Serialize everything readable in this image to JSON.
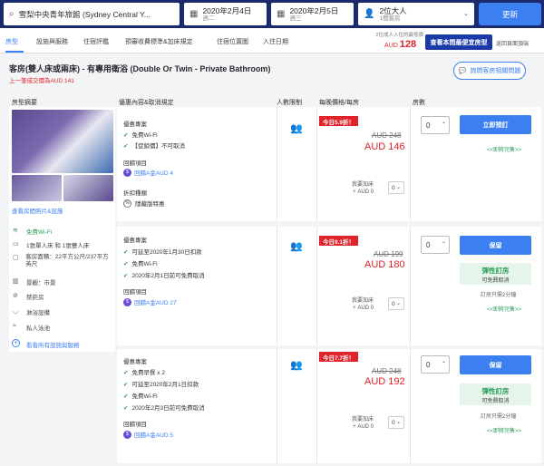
{
  "search": {
    "hotel": "雪梨中央青年旅館 (Sydney Central Y...",
    "checkin_date": "2020年2月4日",
    "checkin_day": "週二",
    "checkout_date": "2020年2月5日",
    "checkout_day": "週三",
    "guests": "2位大人",
    "rooms": "1間客房",
    "update_button": "更新"
  },
  "tabs": [
    "房型",
    "設施與服務",
    "住宿評鑑",
    "預審收費標準&加床規定",
    "住宿位置圖",
    "入住日期"
  ],
  "header": {
    "note": "2位成人入住的最低價",
    "price_prefix": "AUD",
    "price_value": "128",
    "best_price_button": "查看本間最便宜房型",
    "back_link": "返回頁面頂端"
  },
  "room": {
    "title": "客房(雙人床或兩床) - 有專用衛浴 (Double Or Twin - Private Bathroom)",
    "previous_price": "上一筆成交價為AUD 141",
    "ask_button": "詢問客房相關問題",
    "photos_link": "查看房間照片&設施"
  },
  "columns": {
    "room_type": "房型摘要",
    "benefits": "優惠內容&取消規定",
    "capacity": "人數限制",
    "price": "每晚價格/每房",
    "rooms": "房數"
  },
  "amenities": [
    {
      "icon": "wifi-icon",
      "label": "免費Wi-Fi"
    },
    {
      "icon": "bed-icon",
      "label": "1張單人床 和 1張雙人床"
    },
    {
      "icon": "size-icon",
      "label": "客房面積：22平方公尺/237平方英尺"
    },
    {
      "icon": "city-view-icon",
      "label": "景觀：市景"
    },
    {
      "icon": "no-smoking-icon",
      "label": "禁菸房"
    },
    {
      "icon": "bath-icon",
      "label": "淋浴設備"
    },
    {
      "icon": "pool-icon",
      "label": "私人泳池"
    }
  ],
  "all_amenities_link": "看看所有設施與服務",
  "offers": [
    {
      "benefits_title": "優惠專案",
      "benefits": [
        "免費Wi-Fi",
        "【促銷價】不可取消"
      ],
      "cashback_title": "回饋項目",
      "cashback": "回饋A金AUD 4",
      "discount_title": "折扣種類",
      "discount": "隱藏版特惠",
      "discount_badge": "今日5.9折！",
      "original_price": "AUD 248",
      "current_price": "AUD 146",
      "extra_bed_label": "我要加床",
      "extra_bed_price": "+ AUD 0",
      "extra_bed_qty": "0",
      "qty": "0",
      "book_button": "立即預訂",
      "few_left": "<<即將完售>>"
    },
    {
      "benefits_title": "優惠專案",
      "benefits": [
        "可延至2020年1月30日扣款",
        "免費Wi-Fi",
        "2020年2月1日前可免費取消"
      ],
      "cashback_title": "回饋項目",
      "cashback": "回饋A金AUD 27",
      "discount_badge": "今日9.1折！",
      "original_price": "AUD 199",
      "current_price": "AUD 180",
      "extra_bed_label": "我要加床",
      "extra_bed_price": "+ AUD 0",
      "extra_bed_qty": "0",
      "qty": "0",
      "book_button": "保留",
      "flex_title": "彈性訂房",
      "flex_sub": "可免費取消",
      "rooms_left": "訂房只需2分鐘",
      "few_left": "<<即將完售>>"
    },
    {
      "benefits_title": "優惠專案",
      "benefits": [
        "免費早餐 x 2",
        "可延至2020年2月1日扣款",
        "免費Wi-Fi",
        "2020年2月3日前可免費取消"
      ],
      "cashback_title": "回饋項目",
      "cashback": "回饋A金AUD 5",
      "discount_badge": "今日7.7折！",
      "original_price": "AUD 248",
      "current_price": "AUD 192",
      "extra_bed_label": "我要加床",
      "extra_bed_price": "+ AUD 0",
      "extra_bed_qty": "0",
      "qty": "0",
      "book_button": "保留",
      "flex_title": "彈性訂房",
      "flex_sub": "可免費取消",
      "rooms_left": "訂房只需2分鐘",
      "few_left": "<<即將完售>>"
    }
  ],
  "colors": {
    "brand": "#1a2a6c",
    "accent": "#3b7ff0",
    "price": "#e0232b",
    "ok": "#2a9d5a"
  }
}
